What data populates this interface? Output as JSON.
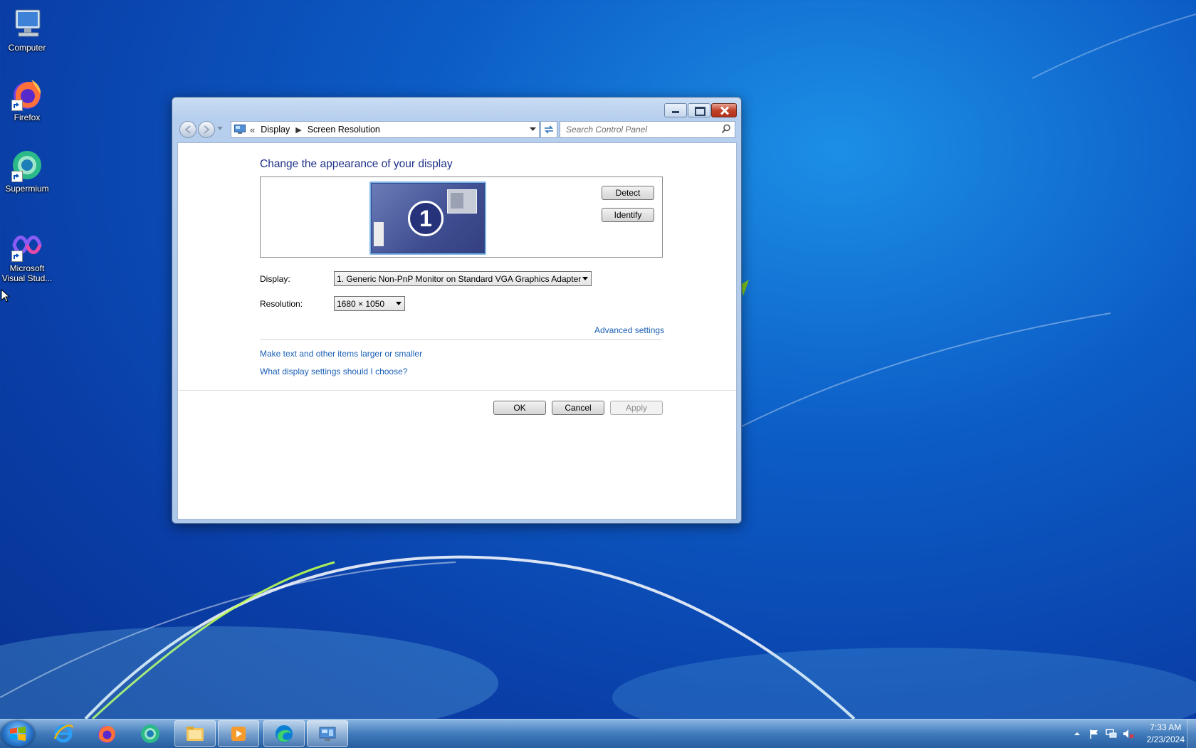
{
  "desktop": {
    "icons": [
      {
        "label": "Computer",
        "icon": "computer-icon"
      },
      {
        "label": "Firefox",
        "icon": "firefox-icon"
      },
      {
        "label": "Supermium",
        "icon": "supermium-icon"
      },
      {
        "label": "Microsoft Visual Stud...",
        "icon": "visual-studio-icon"
      }
    ]
  },
  "window": {
    "breadcrumb": {
      "overflow": "«",
      "items": [
        "Display",
        "Screen Resolution"
      ]
    },
    "search_placeholder": "Search Control Panel",
    "heading": "Change the appearance of your display",
    "monitor_number": "1",
    "detect_label": "Detect",
    "identify_label": "Identify",
    "display_label": "Display:",
    "display_value": "1. Generic Non-PnP Monitor on Standard VGA Graphics Adapter",
    "resolution_label": "Resolution:",
    "resolution_value": "1680 × 1050",
    "advanced_link": "Advanced settings",
    "links": [
      "Make text and other items larger or smaller",
      "What display settings should I choose?"
    ],
    "ok_label": "OK",
    "cancel_label": "Cancel",
    "apply_label": "Apply"
  },
  "taskbar": {
    "pinned": [
      "internet-explorer-icon",
      "firefox-icon",
      "supermium-icon",
      "file-explorer-icon",
      "media-player-icon",
      "edge-icon",
      "control-panel-icon"
    ],
    "clock_time": "7:33 AM",
    "clock_date": "2/23/2024"
  },
  "colors": {
    "heading": "#1e3287",
    "link": "#1a5fb4",
    "desktop": "#0c5cc6"
  }
}
